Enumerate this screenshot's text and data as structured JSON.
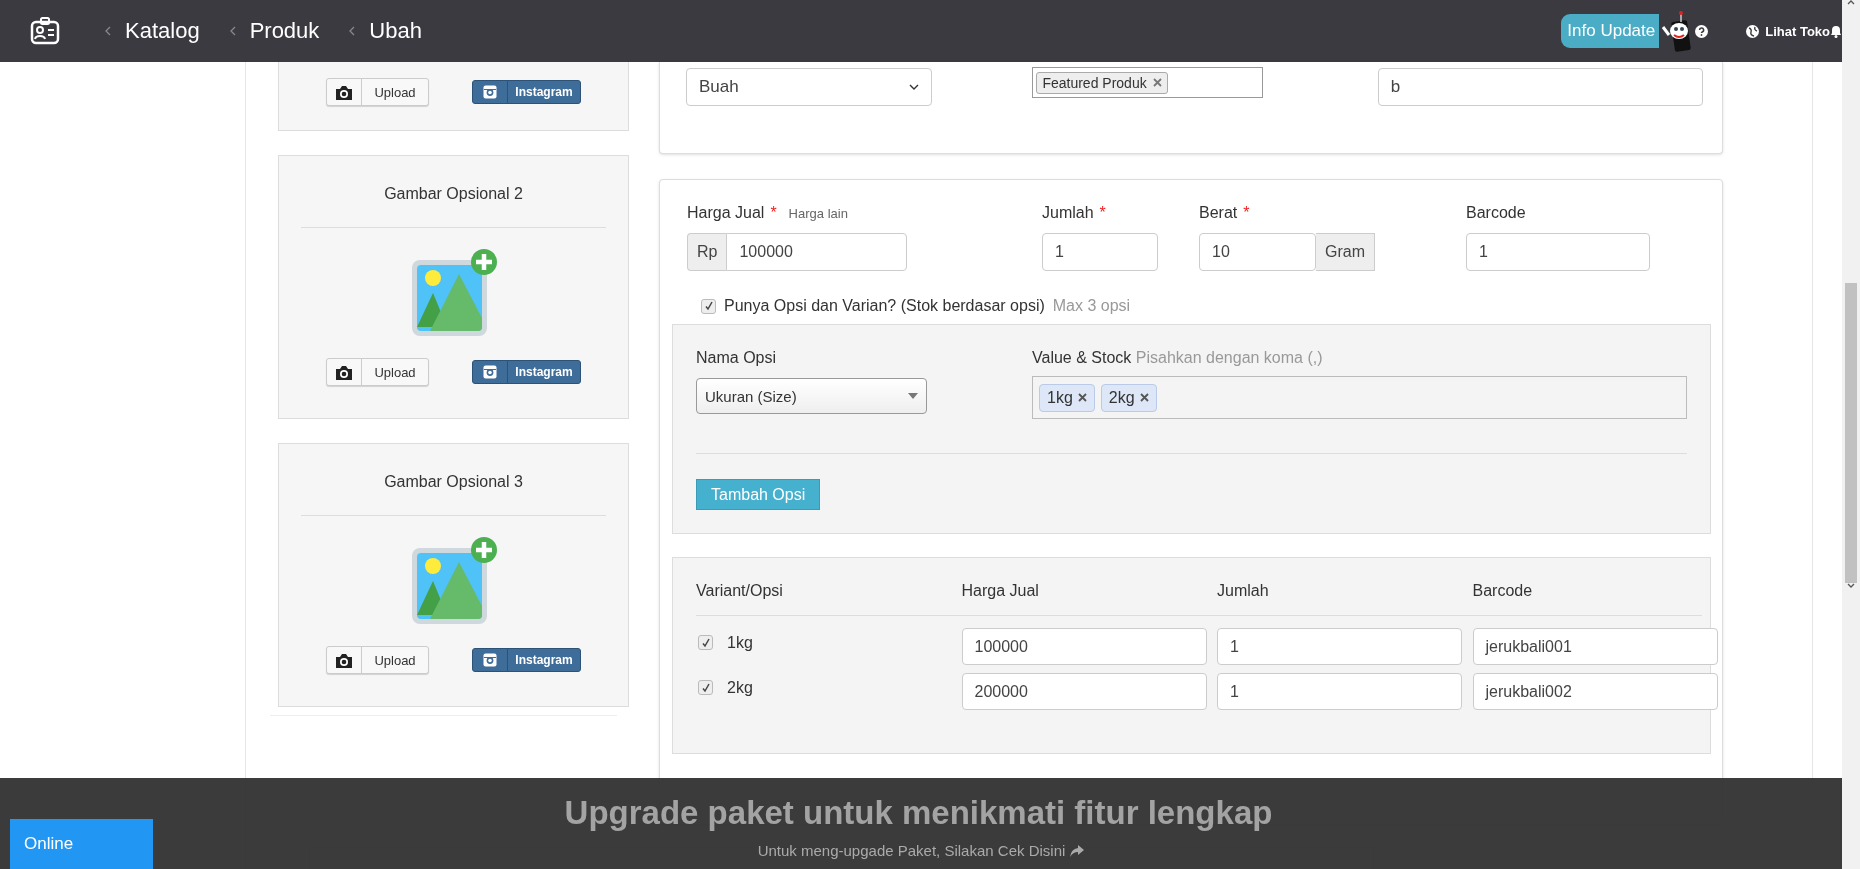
{
  "topbar": {
    "breadcrumbs": [
      "Katalog",
      "Produk",
      "Ubah"
    ],
    "info_button": "Info Update",
    "store_link": "Lihat Toko"
  },
  "image_cards": [
    {
      "upload": "Upload",
      "instagram": "Instagram"
    },
    {
      "title": "Gambar Opsional 2",
      "upload": "Upload",
      "instagram": "Instagram"
    },
    {
      "title": "Gambar Opsional 3",
      "upload": "Upload",
      "instagram": "Instagram"
    }
  ],
  "category_card": {
    "category": "Buah",
    "tags": [
      "Featured Produk"
    ],
    "field_3": "b"
  },
  "pricing": {
    "fields": [
      {
        "label": "Harga Jual",
        "required_mark": "*",
        "hint": "Harga lain",
        "prefix": "Rp",
        "value": "100000"
      },
      {
        "label": "Jumlah",
        "required_mark": "*",
        "value": "1"
      },
      {
        "label": "Berat",
        "required_mark": "*",
        "value": "10",
        "suffix": "Gram"
      },
      {
        "label": "Barcode",
        "value": "1"
      }
    ],
    "variant_toggle": {
      "checked": true,
      "label": "Punya Opsi dan Varian? (Stok berdasar opsi)",
      "hint": "Max 3 opsi"
    },
    "options": {
      "name_label": "Nama Opsi",
      "name_value": "Ukuran (Size)",
      "values_label": "Value & Stock",
      "values_hint": "Pisahkan dengan koma (,)",
      "values": [
        "1kg",
        "2kg"
      ],
      "add_button": "Tambah Opsi"
    },
    "variants": {
      "columns": [
        "Variant/Opsi",
        "Harga Jual",
        "Jumlah",
        "Barcode"
      ],
      "rows": [
        {
          "name": "1kg",
          "checked": true,
          "price": "100000",
          "qty": "1",
          "barcode": "jerukbali001"
        },
        {
          "name": "2kg",
          "checked": true,
          "price": "200000",
          "qty": "1",
          "barcode": "jerukbali002"
        }
      ]
    }
  },
  "upgrade_banner": {
    "title": "Upgrade paket untuk menikmati fitur lengkap",
    "text": "Untuk meng-upgade Paket, Silakan Cek Disini"
  },
  "chat": {
    "label": "Online"
  }
}
